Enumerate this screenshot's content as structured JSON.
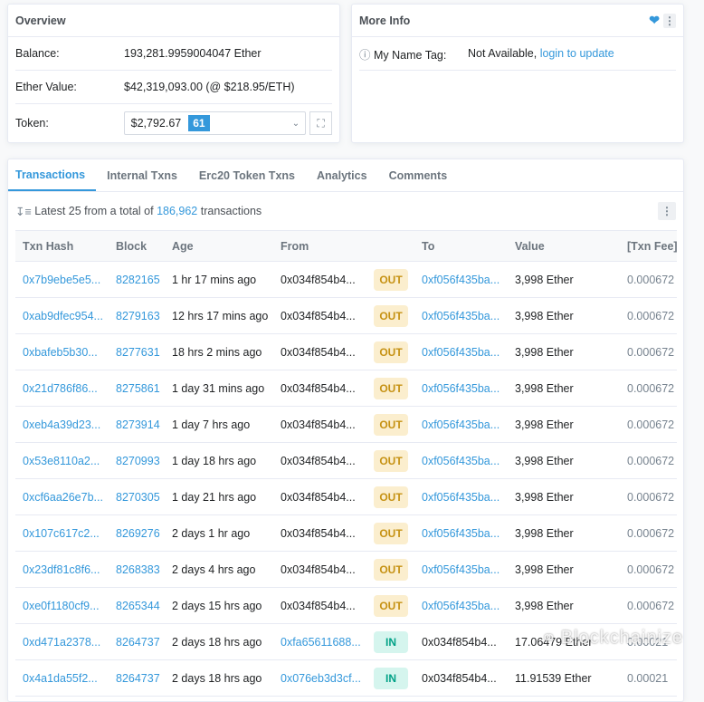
{
  "overview": {
    "title": "Overview",
    "balance_label": "Balance:",
    "balance": "193,281.9959004047 Ether",
    "ether_value_label": "Ether Value:",
    "ether_value": "$42,319,093.00 (@ $218.95/ETH)",
    "token_label": "Token:",
    "token_value": "$2,792.67",
    "token_count": "61"
  },
  "more_info": {
    "title": "More Info",
    "name_tag_label": "My Name Tag:",
    "name_tag_value": "Not Available,",
    "login_link": "login to update"
  },
  "tabs": [
    {
      "label": "Transactions",
      "active": true
    },
    {
      "label": "Internal Txns"
    },
    {
      "label": "Erc20 Token Txns"
    },
    {
      "label": "Analytics"
    },
    {
      "label": "Comments"
    }
  ],
  "summary": {
    "prefix": "Latest 25 from a total of",
    "count": "186,962",
    "suffix": "transactions"
  },
  "table": {
    "headers": [
      "Txn Hash",
      "Block",
      "Age",
      "From",
      "",
      "To",
      "Value",
      "[Txn Fee]"
    ],
    "rows": [
      {
        "hash": "0x7b9ebe5e5...",
        "block": "8282165",
        "age": "1 hr 17 mins ago",
        "from": "0x034f854b4...",
        "dir": "OUT",
        "to": "0xf056f435ba...",
        "value": "3,998 Ether",
        "fee": "0.000672"
      },
      {
        "hash": "0xab9dfec954...",
        "block": "8279163",
        "age": "12 hrs 17 mins ago",
        "from": "0x034f854b4...",
        "dir": "OUT",
        "to": "0xf056f435ba...",
        "value": "3,998 Ether",
        "fee": "0.000672"
      },
      {
        "hash": "0xbafeb5b30...",
        "block": "8277631",
        "age": "18 hrs 2 mins ago",
        "from": "0x034f854b4...",
        "dir": "OUT",
        "to": "0xf056f435ba...",
        "value": "3,998 Ether",
        "fee": "0.000672"
      },
      {
        "hash": "0x21d786f86...",
        "block": "8275861",
        "age": "1 day 31 mins ago",
        "from": "0x034f854b4...",
        "dir": "OUT",
        "to": "0xf056f435ba...",
        "value": "3,998 Ether",
        "fee": "0.000672"
      },
      {
        "hash": "0xeb4a39d23...",
        "block": "8273914",
        "age": "1 day 7 hrs ago",
        "from": "0x034f854b4...",
        "dir": "OUT",
        "to": "0xf056f435ba...",
        "value": "3,998 Ether",
        "fee": "0.000672"
      },
      {
        "hash": "0x53e8110a2...",
        "block": "8270993",
        "age": "1 day 18 hrs ago",
        "from": "0x034f854b4...",
        "dir": "OUT",
        "to": "0xf056f435ba...",
        "value": "3,998 Ether",
        "fee": "0.000672"
      },
      {
        "hash": "0xcf6aa26e7b...",
        "block": "8270305",
        "age": "1 day 21 hrs ago",
        "from": "0x034f854b4...",
        "dir": "OUT",
        "to": "0xf056f435ba...",
        "value": "3,998 Ether",
        "fee": "0.000672"
      },
      {
        "hash": "0x107c617c2...",
        "block": "8269276",
        "age": "2 days 1 hr ago",
        "from": "0x034f854b4...",
        "dir": "OUT",
        "to": "0xf056f435ba...",
        "value": "3,998 Ether",
        "fee": "0.000672"
      },
      {
        "hash": "0x23df81c8f6...",
        "block": "8268383",
        "age": "2 days 4 hrs ago",
        "from": "0x034f854b4...",
        "dir": "OUT",
        "to": "0xf056f435ba...",
        "value": "3,998 Ether",
        "fee": "0.000672"
      },
      {
        "hash": "0xe0f1180cf9...",
        "block": "8265344",
        "age": "2 days 15 hrs ago",
        "from": "0x034f854b4...",
        "dir": "OUT",
        "to": "0xf056f435ba...",
        "value": "3,998 Ether",
        "fee": "0.000672"
      },
      {
        "hash": "0xd471a2378...",
        "block": "8264737",
        "age": "2 days 18 hrs ago",
        "from": "0xfa65611688...",
        "dir": "IN",
        "to": "0x034f854b4...",
        "value": "17.06479 Ether",
        "fee": "0.00021"
      },
      {
        "hash": "0x4a1da55f2...",
        "block": "8264737",
        "age": "2 days 18 hrs ago",
        "from": "0x076eb3d3cf...",
        "dir": "IN",
        "to": "0x034f854b4...",
        "value": "11.91539 Ether",
        "fee": "0.00021"
      }
    ]
  },
  "watermark": "Blockchainize",
  "colors": {
    "accent": "#3498db",
    "out_badge": "#fbeece",
    "in_badge": "#d5f5ee"
  }
}
